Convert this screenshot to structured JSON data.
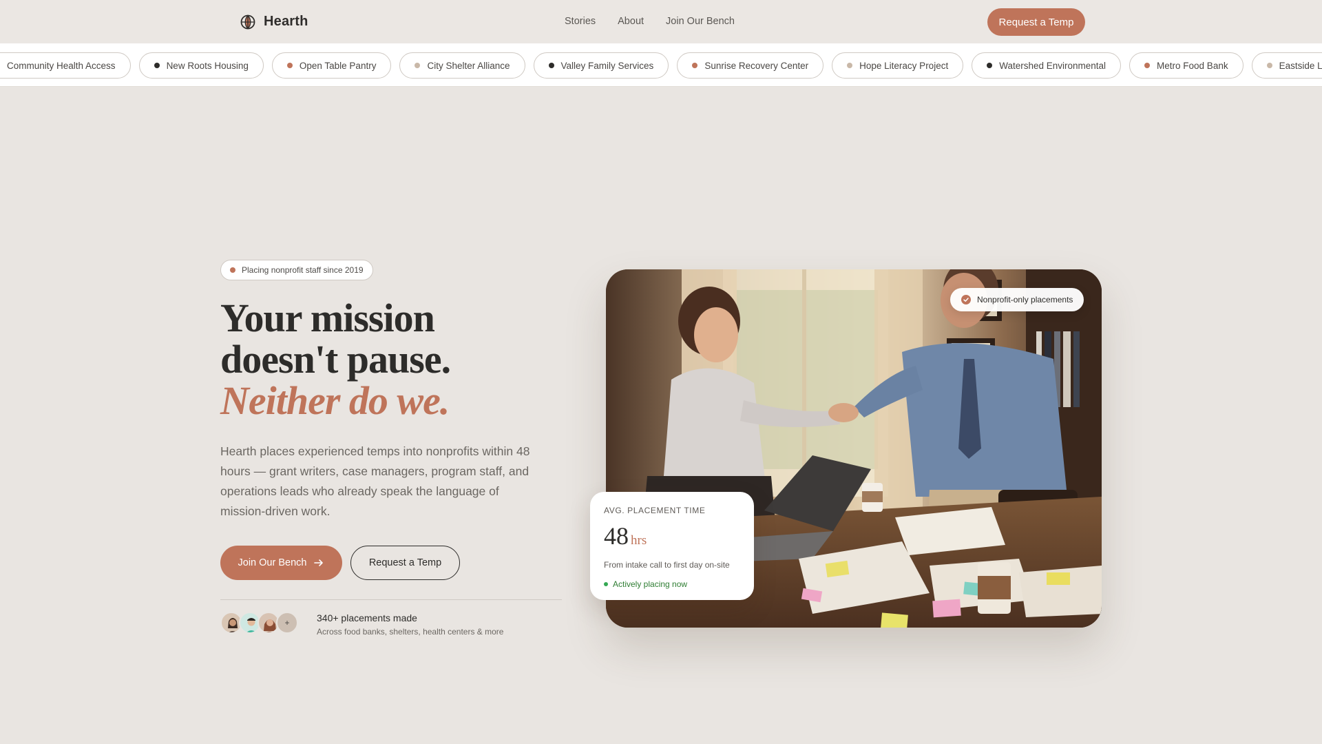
{
  "brand": {
    "name": "Hearth",
    "icon": "globe-icon"
  },
  "nav": {
    "links": [
      "Stories",
      "About",
      "Join Our Bench"
    ],
    "cta": "Request a Temp"
  },
  "marquee": {
    "items": [
      {
        "label": "Community Health Access",
        "dot": "#bf745a"
      },
      {
        "label": "New Roots Housing",
        "dot": "#2d2c2a"
      },
      {
        "label": "Open Table Pantry",
        "dot": "#bf745a"
      },
      {
        "label": "City Shelter Alliance",
        "dot": "#c9b8a8"
      },
      {
        "label": "Valley Family Services",
        "dot": "#2d2c2a"
      },
      {
        "label": "Sunrise Recovery Center",
        "dot": "#bf745a"
      },
      {
        "label": "Hope Literacy Project",
        "dot": "#c9b8a8"
      },
      {
        "label": "Watershed Environmental",
        "dot": "#2d2c2a"
      },
      {
        "label": "Metro Food Bank",
        "dot": "#bf745a"
      },
      {
        "label": "Eastside Legal Aid",
        "dot": "#c9b8a8"
      }
    ]
  },
  "hero": {
    "badge": "Placing nonprofit staff since 2019",
    "headline_line1": "Your mission",
    "headline_line2": "doesn't pause.",
    "headline_accent": "Neither do we.",
    "lead": "Hearth places experienced temps into nonprofits within 48 hours — grant writers, case managers, program staff, and operations leads who already speak the language of mission-driven work.",
    "primary_cta": "Join Our Bench",
    "secondary_cta": "Request a Temp",
    "avatar_more": "+",
    "stats_title": "340+ placements made",
    "stats_sub": "Across food banks, shelters, health centers & more"
  },
  "photo": {
    "pill": "Nonprofit-only placements",
    "stat_label": "AVG. PLACEMENT TIME",
    "stat_value": "48",
    "stat_unit": "hrs",
    "stat_desc": "From intake call to first day on-site",
    "stat_live": "Actively placing now"
  },
  "colors": {
    "accent": "#bf745a",
    "background": "#e9e5e1",
    "live": "#34a853"
  }
}
